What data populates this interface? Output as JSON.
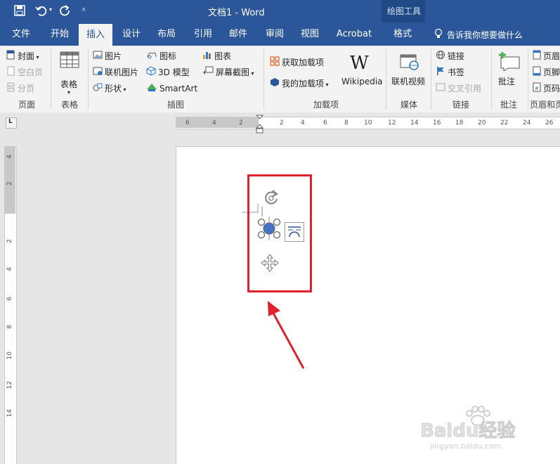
{
  "titlebar": {
    "title": "文档1  -  Word",
    "contextual_label": "绘图工具"
  },
  "tabs": [
    "文件",
    "开始",
    "插入",
    "设计",
    "布局",
    "引用",
    "邮件",
    "审阅",
    "视图",
    "Acrobat",
    "格式"
  ],
  "tell_me": "告诉我你想要做什么",
  "ribbon": {
    "pages": {
      "cover": "封面",
      "blank": "空白页",
      "break": "分页",
      "group": "页面"
    },
    "table": {
      "label": "表格",
      "group": "表格"
    },
    "illustrations": {
      "picture": "图片",
      "online_picture": "联机图片",
      "shapes": "形状",
      "icons": "图标",
      "model3d": "3D 模型",
      "smartart": "SmartArt",
      "chart": "图表",
      "screenshot": "屏幕截图",
      "group": "插图"
    },
    "addins": {
      "get": "获取加载项",
      "my": "我的加载项",
      "wiki_logo": "W",
      "wiki": "Wikipedia",
      "group": "加载项"
    },
    "media": {
      "video": "联机视频",
      "group": "媒体"
    },
    "links": {
      "link": "链接",
      "bookmark": "书签",
      "cross": "交叉引用",
      "group": "链接"
    },
    "comments": {
      "comment": "批注",
      "group": "批注"
    },
    "header": {
      "hdr": "页眉",
      "ftr": "页脚",
      "pgnum": "页码",
      "group": "页眉和页"
    }
  },
  "ruler_tab_stop": "L",
  "hruler_numbers": [
    "6",
    "4",
    "2",
    "",
    "2",
    "4",
    "6",
    "8",
    "10",
    "12",
    "14",
    "16",
    "18",
    "20",
    "22",
    "24",
    "26"
  ],
  "vruler_numbers": [
    "4",
    "2",
    "",
    "2",
    "4",
    "6",
    "8",
    "10",
    "12",
    "14"
  ],
  "colors": {
    "accent": "#2b579a",
    "highlight_box": "#e0202a",
    "handle_fill": "#4472c4"
  },
  "watermark": {
    "logo": "Baidu经验",
    "url": "jingyan.baidu.com"
  }
}
